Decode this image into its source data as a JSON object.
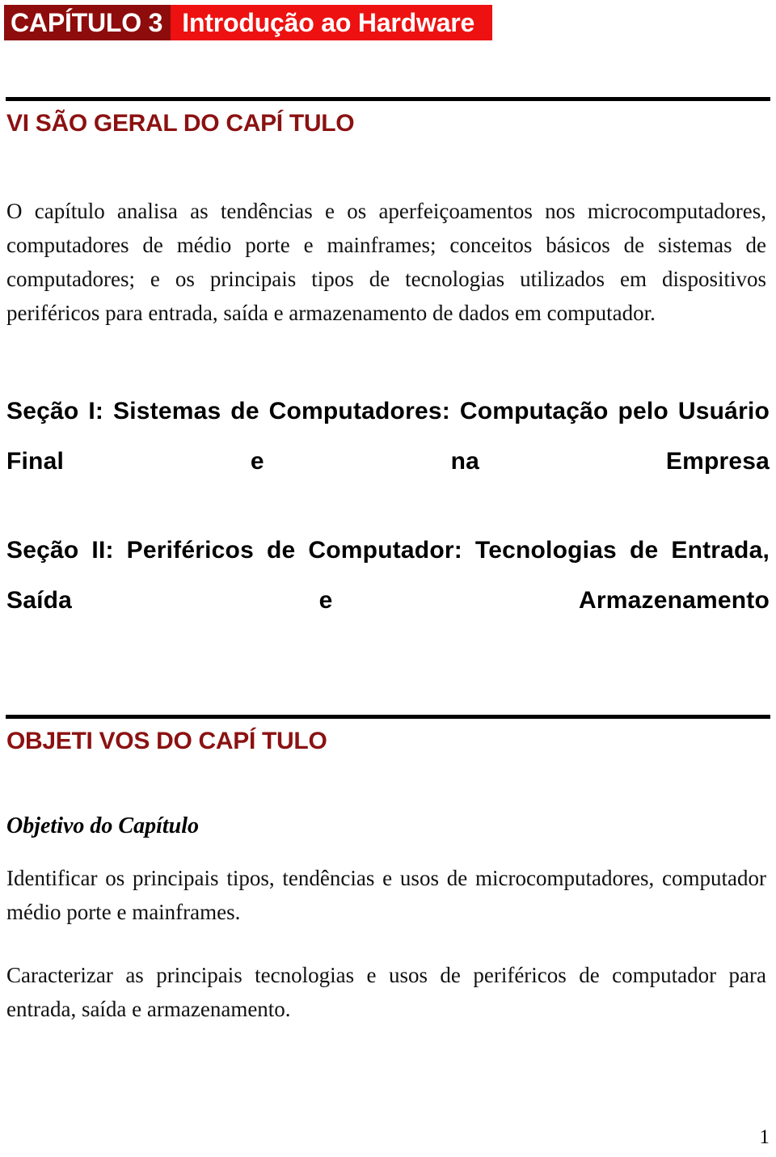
{
  "banner": {
    "chapter_label": "CAPÍTULO 3",
    "title": "Introdução ao Hardware",
    "chapter_bg": "#8E0C0C",
    "title_bg": "#ED1111",
    "text_color": "#FFFFFF"
  },
  "sections": {
    "overview_heading": "VI SÃO GERAL DO CAPÍ TULO",
    "overview_paragraph": "O capítulo analisa as tendências e os aperfeiçoamentos nos microcomputadores, computadores de médio porte e mainframes; conceitos básicos de sistemas de computadores; e os principais tipos de tecnologias utilizados em dispositivos periféricos para entrada, saída e armazenamento de dados em computador.",
    "secao_1": "Seção I: Sistemas de Computadores: Computação pelo Usuário Final e na Empresa",
    "secao_2": "Seção II: Periféricos de Computador: Tecnologias de Entrada, Saída e Armazenamento",
    "objectives_heading": "OBJETI VOS DO CAPÍ TULO",
    "objective_label": "Objetivo do Capítulo",
    "objective_1": "Identificar os principais tipos, tendências e usos de microcomputadores, computador médio porte e mainframes.",
    "objective_2": "Caracterizar as principais tecnologias e usos de periféricos de computador para entrada, saída e armazenamento."
  },
  "footer": {
    "page_number": "1"
  },
  "colors": {
    "heading_red": "#8B1111",
    "banner_dark_red": "#8E0C0C",
    "banner_bright_red": "#ED1111",
    "rule_black": "#000000",
    "body_text": "#111111"
  }
}
